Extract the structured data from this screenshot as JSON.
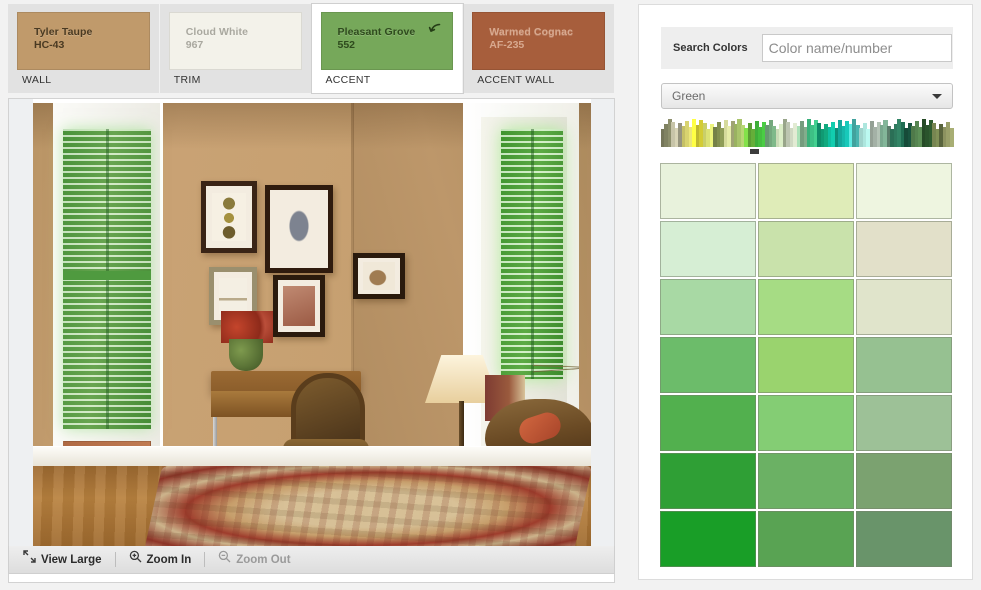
{
  "visualizer": {
    "swatches": [
      {
        "name": "Tyler Taupe",
        "code": "HC-43",
        "role": "WALL",
        "hex": "#c09a6b",
        "text": "#4a3a22",
        "selected": false,
        "revert": false
      },
      {
        "name": "Cloud White",
        "code": "967",
        "role": "TRIM",
        "hex": "#f3f2ea",
        "text": "#a9a89f",
        "selected": false,
        "revert": false
      },
      {
        "name": "Pleasant Grove",
        "code": "552",
        "role": "ACCENT",
        "hex": "#76a85a",
        "text": "#2e4a1d",
        "selected": true,
        "revert": true,
        "revert_icon": "undo-arrow-icon"
      },
      {
        "name": "Warmed Cognac",
        "code": "AF-235",
        "role": "ACCENT WALL",
        "hex": "#a75e3c",
        "text": "#d8a98f",
        "selected": false,
        "revert": false
      }
    ],
    "toolbar": {
      "view_large": {
        "label": "View Large",
        "icon": "expand-arrows-icon",
        "disabled": false
      },
      "zoom_in": {
        "label": "Zoom In",
        "icon": "magnifier-plus-icon",
        "disabled": false
      },
      "zoom_out": {
        "label": "Zoom Out",
        "icon": "magnifier-minus-icon",
        "disabled": true
      }
    },
    "room_scene": {
      "description": "Home office room scene with green louvered shutters, taupe walls, wood desk, upholstered chair, floor lamp and Persian rug",
      "wall_hex": "#c09a6b",
      "trim_hex": "#f6f5ee",
      "shutter_hex": "#63b048",
      "accent_wall_hex": "#b06a44",
      "floor_hex": "#a8702f"
    }
  },
  "picker": {
    "search": {
      "label": "Search Colors",
      "placeholder": "Color name/number",
      "value": ""
    },
    "family": {
      "selected": "Green",
      "caret_icon": "chevron-down-icon"
    },
    "spectrum": {
      "marker_position_pct": 32,
      "stops": [
        "#8d8f6c",
        "#b7b49a",
        "#d8d36f",
        "#e8e03a",
        "#c9cf6a",
        "#8f9d57",
        "#c3c88e",
        "#a9c46b",
        "#6fbf3f",
        "#3fae3a",
        "#7fb98a",
        "#b9c9a8",
        "#cfd8c2",
        "#8fbe9a",
        "#39b07a",
        "#12a97e",
        "#0fae94",
        "#16b8ab",
        "#4fc6c0",
        "#9fd3cc",
        "#b4c3b6",
        "#6f9a82",
        "#2f7a5e",
        "#1b5c46",
        "#4f7a4a",
        "#2e5c30",
        "#6d7a4a",
        "#9aa06a"
      ]
    },
    "grid": {
      "columns": 3,
      "rows": 7,
      "colors": [
        [
          "#e8f2dc",
          "#dfecb8",
          "#eef5e0"
        ],
        [
          "#d6eed4",
          "#c9e2ab",
          "#e2e0c9"
        ],
        [
          "#a8d9a4",
          "#a6dc84",
          "#e0e4cb"
        ],
        [
          "#6cbc6a",
          "#9ad36e",
          "#96c191"
        ],
        [
          "#52b04e",
          "#84cd74",
          "#9dc197"
        ],
        [
          "#2f9f35",
          "#6bb164",
          "#7ba270",
          "#"
        ],
        [
          "#199e27",
          "#59a353",
          "#69946a"
        ]
      ]
    }
  }
}
